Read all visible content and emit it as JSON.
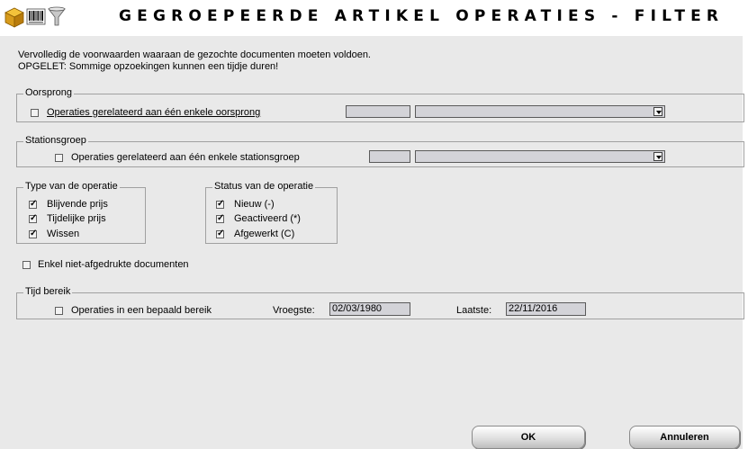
{
  "window": {
    "title": "GEGROEPEERDE ARTIKEL OPERATIES - FILTER",
    "icons": [
      "box-icon",
      "barcode-icon",
      "funnel-icon"
    ]
  },
  "intro": {
    "line1": "Vervolledig de voorwaarden waaraan de gezochte documenten moeten voldoen.",
    "line2": "OPGELET: Sommige opzoekingen kunnen een tijdje duren!"
  },
  "oorsprong": {
    "legend": "Oorsprong",
    "checkbox_label": "Operaties gerelateerd aan één enkele oorsprong",
    "checked": false,
    "code_value": "",
    "dropdown_value": ""
  },
  "stationsgroep": {
    "legend": "Stationsgroep",
    "checkbox_label": "Operaties gerelateerd aan één enkele stationsgroep",
    "checked": false,
    "code_value": "",
    "dropdown_value": ""
  },
  "type_operatie": {
    "legend": "Type van de operatie",
    "options": [
      {
        "label": "Blijvende prijs",
        "checked": true
      },
      {
        "label": "Tijdelijke prijs",
        "checked": true
      },
      {
        "label": "Wissen",
        "checked": true
      }
    ]
  },
  "status_operatie": {
    "legend": "Status van de operatie",
    "options": [
      {
        "label": "Nieuw (-)",
        "checked": true
      },
      {
        "label": "Geactiveerd (*)",
        "checked": true
      },
      {
        "label": "Afgewerkt (C)",
        "checked": true
      }
    ]
  },
  "niet_afgedrukt": {
    "label": "Enkel niet-afgedrukte documenten",
    "checked": false
  },
  "tijd_bereik": {
    "legend": "Tijd bereik",
    "checkbox_label": "Operaties in een bepaald bereik",
    "checked": false,
    "earliest_label": "Vroegste:",
    "earliest_value": "02/03/1980",
    "latest_label": "Laatste:",
    "latest_value": "22/11/2016"
  },
  "buttons": {
    "ok": "OK",
    "cancel": "Annuleren"
  }
}
